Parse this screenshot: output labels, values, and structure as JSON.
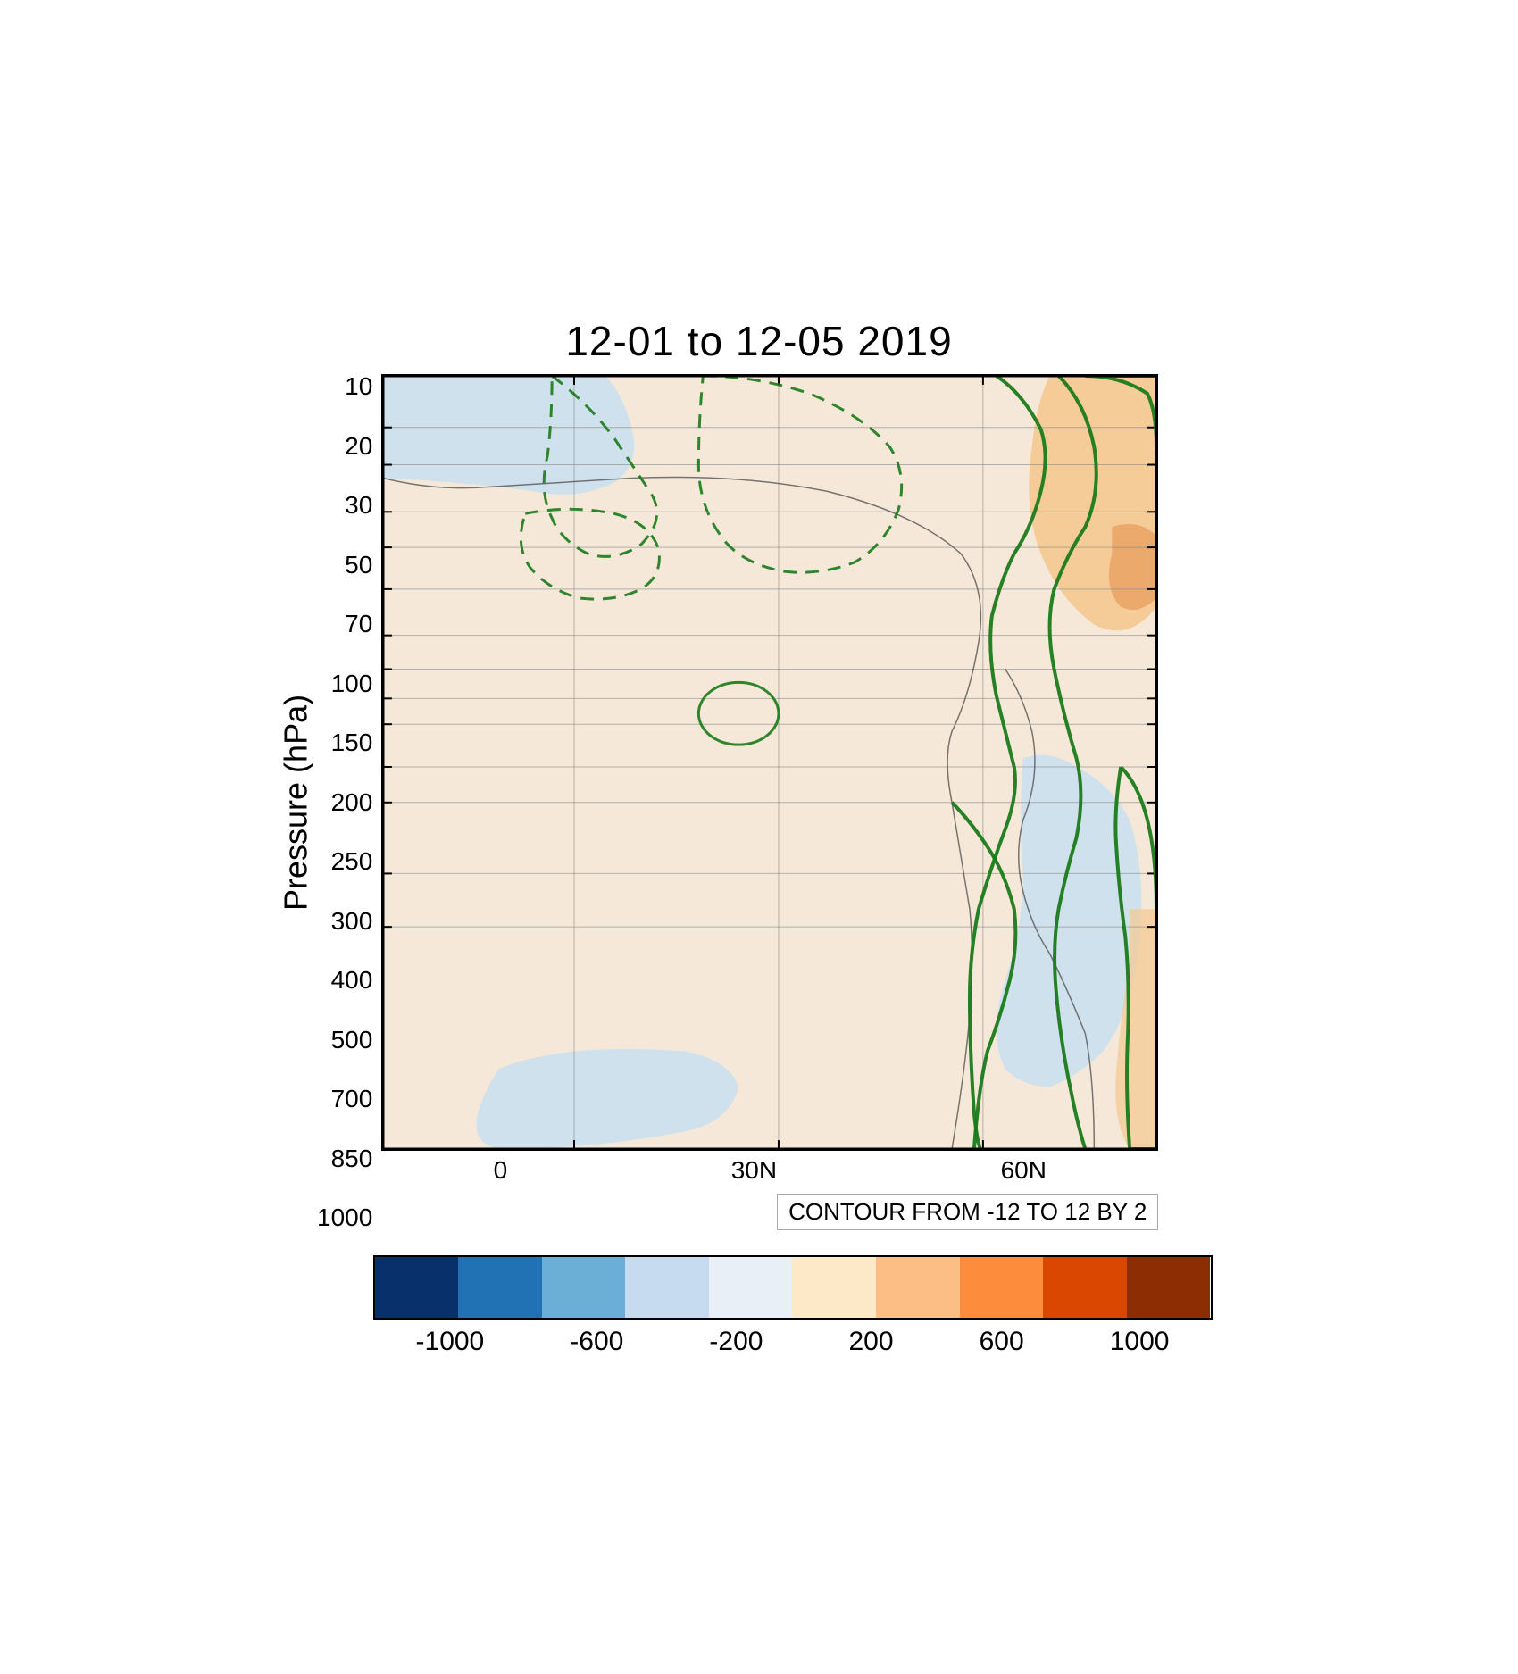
{
  "title": "12-01 to 12-05 2019",
  "yaxis_label": "Pressure (hPa)",
  "y_ticks": [
    "10",
    "20",
    "30",
    "50",
    "70",
    "100",
    "150",
    "200",
    "250",
    "300",
    "400",
    "500",
    "700",
    "850",
    "1000"
  ],
  "x_ticks": [
    "0",
    "30N",
    "60N"
  ],
  "contour_note": "CONTOUR FROM -12 TO 12 BY 2",
  "colorbar": {
    "segments": [
      {
        "color": "#08306b"
      },
      {
        "color": "#2171b5"
      },
      {
        "color": "#6baed6"
      },
      {
        "color": "#c6dbef"
      },
      {
        "color": "#f0f4f8"
      },
      {
        "color": "#fde8c8"
      },
      {
        "color": "#fdbe85"
      },
      {
        "color": "#fd8d3c"
      },
      {
        "color": "#d94701"
      },
      {
        "color": "#8c2d04"
      }
    ],
    "labels": [
      "-1000",
      "-600",
      "-200",
      "200",
      "600",
      "1000"
    ]
  }
}
